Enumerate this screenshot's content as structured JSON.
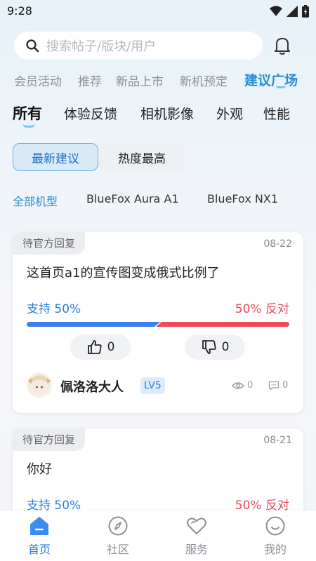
{
  "status_bar": {
    "time": "9:28"
  },
  "search": {
    "placeholder": "搜索帖子/版块/用户"
  },
  "top_nav": [
    "会员活动",
    "推荐",
    "新品上市",
    "新机预定",
    "建议广场"
  ],
  "top_nav_active": "建议广场",
  "category_tabs": [
    "所有",
    "体验反馈",
    "相机影像",
    "外观",
    "性能"
  ],
  "category_active": "所有",
  "sort": {
    "latest": "最新建议",
    "hot": "热度最高",
    "active": "最新建议"
  },
  "models": [
    "全部机型",
    "BlueFox Aura A1",
    "BlueFox NX1"
  ],
  "model_active": "全部机型",
  "posts": [
    {
      "badge": "待官方回复",
      "date": "08-22",
      "title": "这首页a1的宣传图变成俄式比例了",
      "support_label": "支持 50%",
      "oppose_label": "50% 反对",
      "support_ratio": 0.5,
      "likes": "0",
      "dislikes": "0",
      "author": "佩洛洛大人",
      "level": "LV5",
      "views": "0",
      "comments": "0"
    },
    {
      "badge": "待官方回复",
      "date": "08-21",
      "title": "你好",
      "support_label": "支持 50%",
      "oppose_label": "50% 反对",
      "support_ratio": 0.5
    }
  ],
  "bottom_tabs": [
    "首页",
    "社区",
    "服务",
    "我的"
  ],
  "bottom_active": "首页",
  "colors": {
    "accent": "#2b7fe0",
    "support": "#3b7ff0",
    "oppose": "#f04a5a",
    "inactive": "#8a8f96"
  },
  "icons": [
    "search-icon",
    "bell-icon",
    "thumbs-up-icon",
    "thumbs-down-icon",
    "eye-icon",
    "comment-icon",
    "home-icon",
    "compass-icon",
    "heart-icon",
    "smile-icon",
    "wifi-icon",
    "signal-icon",
    "battery-icon"
  ]
}
